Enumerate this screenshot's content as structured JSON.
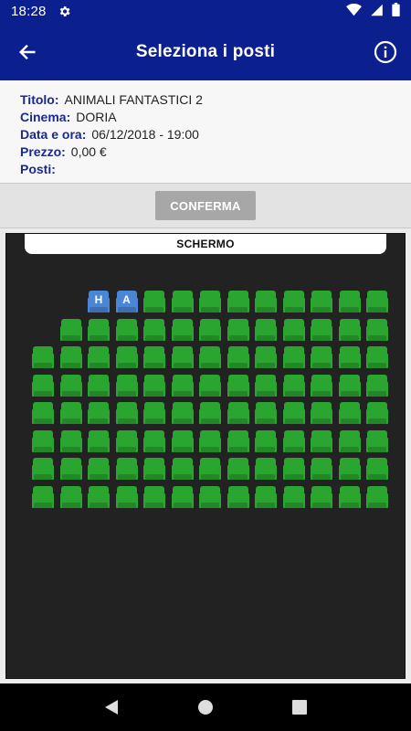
{
  "status_bar": {
    "time": "18:28"
  },
  "app_bar": {
    "title": "Seleziona i posti"
  },
  "details": {
    "rows": [
      {
        "label": "Titolo:",
        "value": "ANIMALI FANTASTICI 2"
      },
      {
        "label": "Cinema:",
        "value": "DORIA"
      },
      {
        "label": "Data e ora:",
        "value": "06/12/2018 - 19:00"
      },
      {
        "label": "Prezzo:",
        "value": "0,00 €"
      },
      {
        "label": "Posti:",
        "value": ""
      }
    ]
  },
  "confirm": {
    "label": "CONFERMA"
  },
  "hall": {
    "screen_label": "SCHERMO",
    "colors": {
      "available": "#2aa52f",
      "special": "#4a86d6"
    },
    "rows": [
      {
        "first_col": 3,
        "count": 11,
        "special": {
          "0": "H",
          "1": "A"
        }
      },
      {
        "first_col": 2,
        "count": 12,
        "special": {}
      },
      {
        "first_col": 1,
        "count": 13,
        "special": {}
      },
      {
        "first_col": 1,
        "count": 13,
        "special": {}
      },
      {
        "first_col": 1,
        "count": 13,
        "special": {}
      },
      {
        "first_col": 1,
        "count": 13,
        "special": {}
      },
      {
        "first_col": 1,
        "count": 13,
        "special": {}
      },
      {
        "first_col": 1,
        "count": 13,
        "special": {}
      }
    ]
  }
}
